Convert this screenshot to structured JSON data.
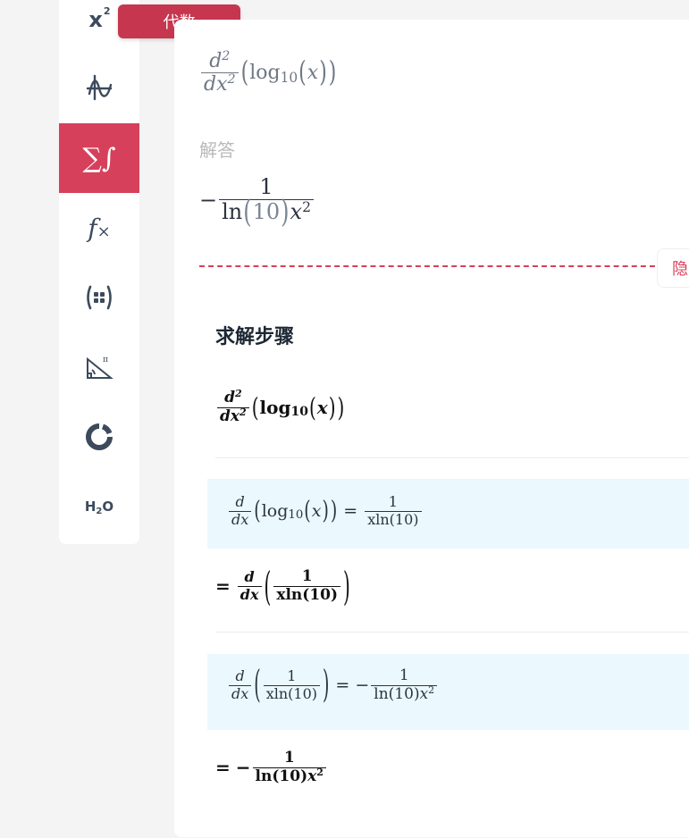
{
  "sidebar": {
    "items": [
      {
        "name": "algebra",
        "label": "x²",
        "tooltip": "代数"
      },
      {
        "name": "functions-graph"
      },
      {
        "name": "calculus"
      },
      {
        "name": "functions"
      },
      {
        "name": "matrix"
      },
      {
        "name": "trigonometry"
      },
      {
        "name": "statistics"
      },
      {
        "name": "chemistry",
        "label": "H₂O"
      }
    ]
  },
  "tooltip": "代数",
  "problem": {
    "d": "d",
    "two": "2",
    "dx": "dx",
    "log": "log",
    "base": "10",
    "x": "x"
  },
  "answer_label": "解答",
  "answer": {
    "minus": "−",
    "one": "1",
    "ln": "ln",
    "ten": "10",
    "x": "x",
    "two": "2"
  },
  "hide_button": "隐",
  "steps_title": "求解步骤",
  "steps": {
    "s1": {
      "d": "d",
      "two": "2",
      "dx": "dx",
      "log": "log",
      "base": "10",
      "x": "x"
    },
    "s2": {
      "d": "d",
      "dx": "dx",
      "log": "log",
      "base": "10",
      "x": "x",
      "eq": "=",
      "one": "1",
      "xln": "xln",
      "ten": "10"
    },
    "s3": {
      "eq": "=",
      "d": "d",
      "dx": "dx",
      "one": "1",
      "xln": "xln",
      "ten": "10"
    },
    "s4": {
      "d": "d",
      "dx": "dx",
      "one": "1",
      "xln": "xln",
      "ten": "10",
      "eq": "=",
      "minus": "−",
      "ln": "ln",
      "x": "x",
      "two": "2"
    },
    "s5": {
      "eq": "=",
      "minus": "−",
      "one": "1",
      "ln": "ln",
      "ten": "10",
      "x": "x",
      "two": "2"
    }
  },
  "colors": {
    "accent": "#d7405b",
    "tooltip": "#c6364f",
    "highlight": "#ebf8fd",
    "icon": "#3c4a5c"
  }
}
